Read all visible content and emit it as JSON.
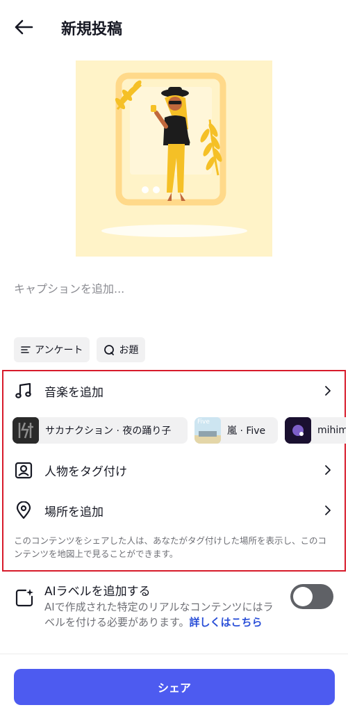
{
  "header": {
    "title": "新規投稿"
  },
  "icons": {
    "back": "arrow-left-icon",
    "poll": "list-lines-icon",
    "topic": "speech-bubble-icon",
    "music": "music-note-icon",
    "tag": "person-frame-icon",
    "location": "location-pin-icon",
    "chevron": "chevron-right-icon",
    "ai": "sparkle-square-icon"
  },
  "caption": {
    "placeholder": "キャプションを追加..."
  },
  "chips": {
    "poll": "アンケート",
    "topic": "お題"
  },
  "music": {
    "label": "音楽を追加",
    "suggestions": [
      {
        "label": "サカナクション · 夜の踊り子"
      },
      {
        "label": "嵐 · Five",
        "cover_text": "Five"
      },
      {
        "label": "mihim"
      }
    ]
  },
  "tag": {
    "label": "人物をタグ付け"
  },
  "location": {
    "label": "場所を追加",
    "note": "このコンテンツをシェアした人は、あなたがタグ付けした場所を表示し、このコンテンツを地図上で見ることができます。"
  },
  "ai_label": {
    "title": "AIラベルを追加する",
    "description": "AIで作成された特定のリアルなコンテンツにはラベルを付ける必要があります。",
    "link": "詳しくはこちら",
    "enabled": false
  },
  "share": {
    "label": "シェア"
  },
  "colors": {
    "accent": "#4d5bf0",
    "highlight_border": "#d71a2a",
    "link": "#2a4fd8",
    "toggle_off": "#5f6166",
    "cover_bg": "#fff3c8"
  }
}
